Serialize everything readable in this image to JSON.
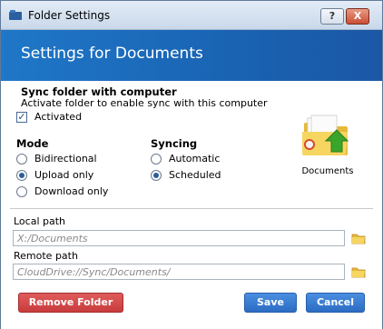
{
  "window": {
    "title": "Folder Settings",
    "help_label": "?",
    "close_label": "X"
  },
  "header": {
    "title": "Settings for Documents"
  },
  "sync": {
    "title": "Sync folder with computer",
    "description": "Activate folder to enable sync with this computer",
    "activated_label": "Activated",
    "activated_checked": true
  },
  "mode": {
    "title": "Mode",
    "options": [
      "Bidirectional",
      "Upload only",
      "Download only"
    ],
    "selected": "Upload only"
  },
  "syncing": {
    "title": "Syncing",
    "options": [
      "Automatic",
      "Scheduled"
    ],
    "selected": "Scheduled"
  },
  "folder": {
    "caption": "Documents",
    "icon": "folder-sync-icon"
  },
  "local_path": {
    "label": "Local path",
    "placeholder": "X:/Documents"
  },
  "remote_path": {
    "label": "Remote path",
    "placeholder": "CloudDrive://Sync/Documents/"
  },
  "buttons": {
    "remove": "Remove Folder",
    "save": "Save",
    "cancel": "Cancel"
  },
  "colors": {
    "header": "#1a63b3",
    "primary_button": "#2c6cc4",
    "danger_button": "#c83c3c"
  }
}
